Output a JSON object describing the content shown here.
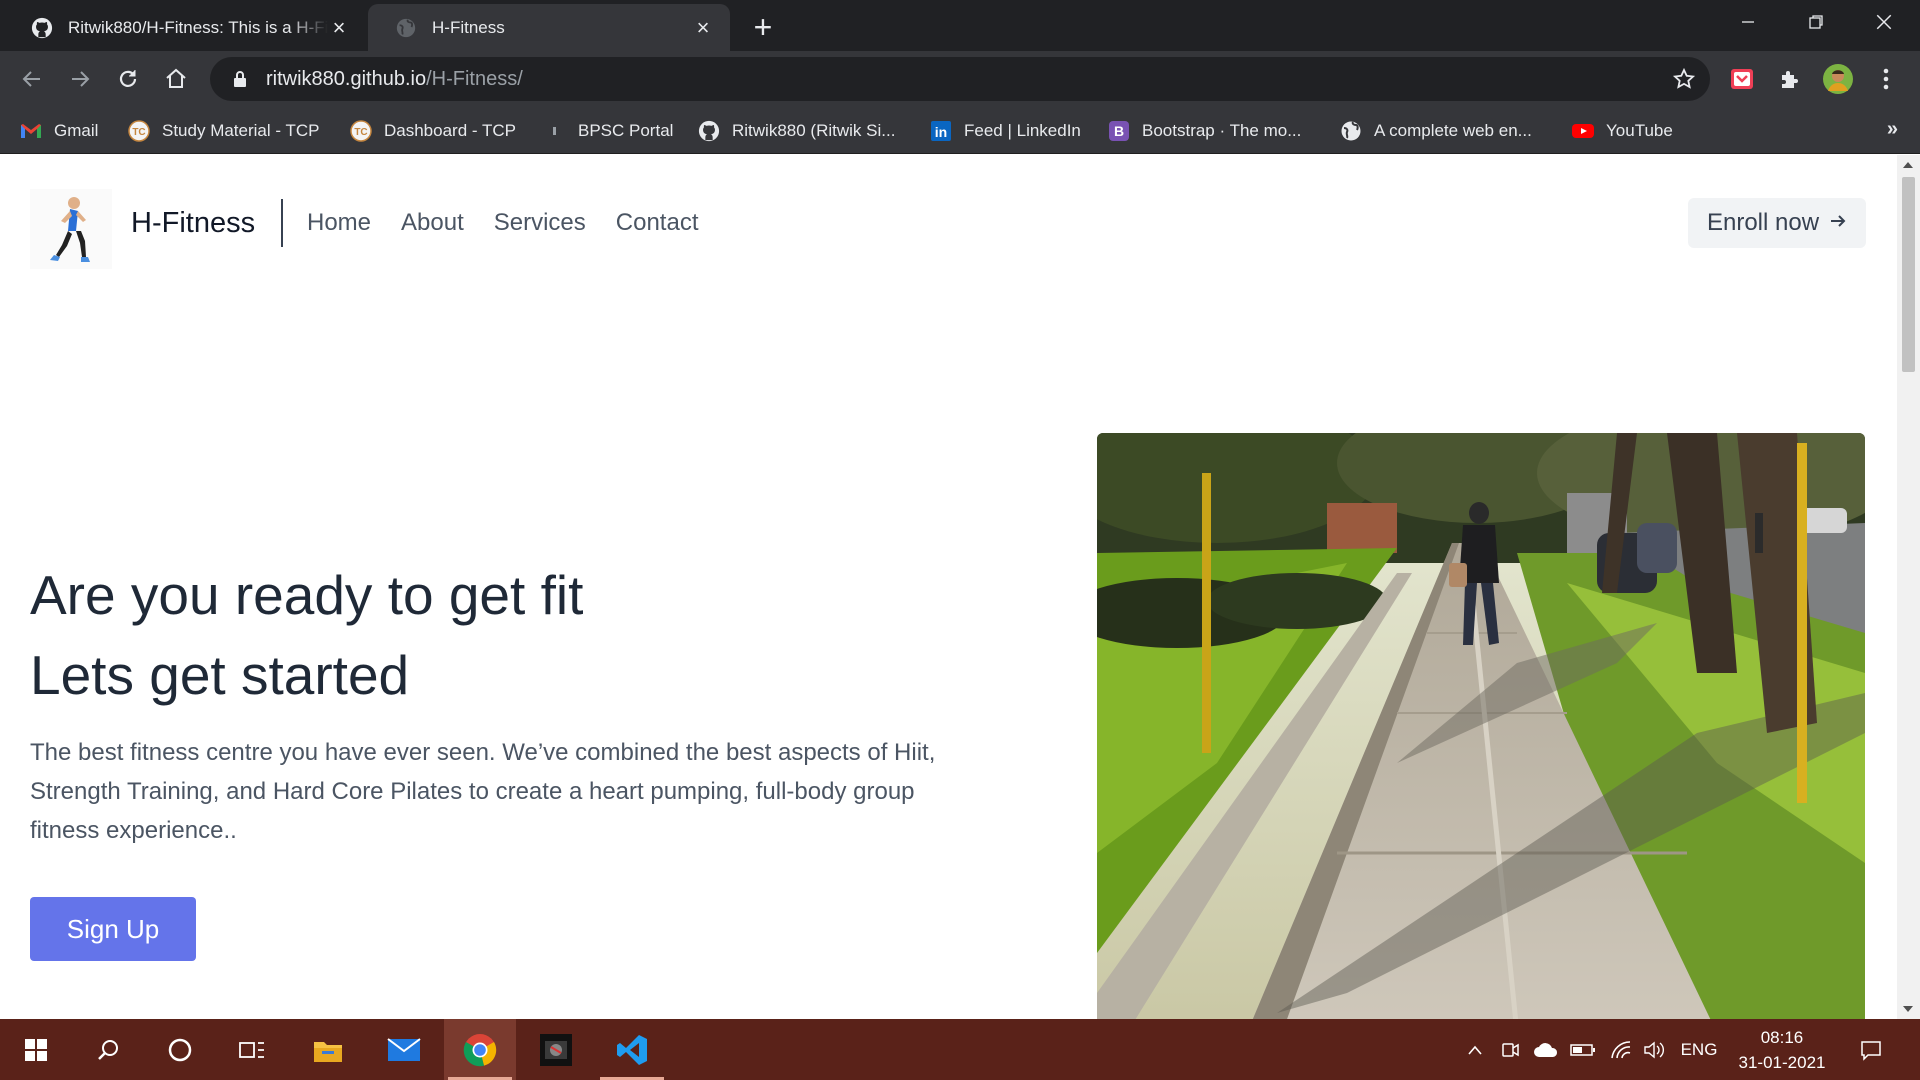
{
  "browser": {
    "tabs": [
      {
        "title": "Ritwik880/H-Fitness: This is a H-Fitness website",
        "active": false
      },
      {
        "title": "H-Fitness",
        "active": true
      }
    ],
    "url_host": "ritwik880.github.io",
    "url_path": "/H-Fitness/",
    "bookmarks": [
      {
        "label": "Gmail",
        "icon": "gmail-icon"
      },
      {
        "label": "Study Material - TCP",
        "icon": "tcp-icon"
      },
      {
        "label": "Dashboard - TCP",
        "icon": "tcp-icon"
      },
      {
        "label": "BPSC Portal",
        "icon": "bpsc-icon"
      },
      {
        "label": "Ritwik880 (Ritwik Si...",
        "icon": "github-icon"
      },
      {
        "label": "Feed | LinkedIn",
        "icon": "linkedin-icon"
      },
      {
        "label": "Bootstrap · The mo...",
        "icon": "bootstrap-icon"
      },
      {
        "label": "A complete web en...",
        "icon": "globe-icon"
      },
      {
        "label": "YouTube",
        "icon": "youtube-icon"
      }
    ],
    "bookmarks_overflow": "»"
  },
  "site": {
    "brand": "H-Fitness",
    "nav": [
      "Home",
      "About",
      "Services",
      "Contact"
    ],
    "enroll_label": "Enroll now",
    "hero_line1": "Are you ready to get fit",
    "hero_line2": "Lets get started",
    "hero_text": "The best fitness centre you have ever seen. We’ve combined the best aspects of Hiit, Strength Training, and Hard Core Pilates to create a heart pumping, full-body group fitness experience..",
    "signup_label": "Sign Up"
  },
  "taskbar": {
    "language": "ENG",
    "time": "08:16",
    "date": "31-01-2021"
  },
  "colors": {
    "accent": "#6474ea",
    "taskbar": "#5a2219",
    "chrome_dark": "#202124",
    "chrome_toolbar": "#35363a"
  }
}
